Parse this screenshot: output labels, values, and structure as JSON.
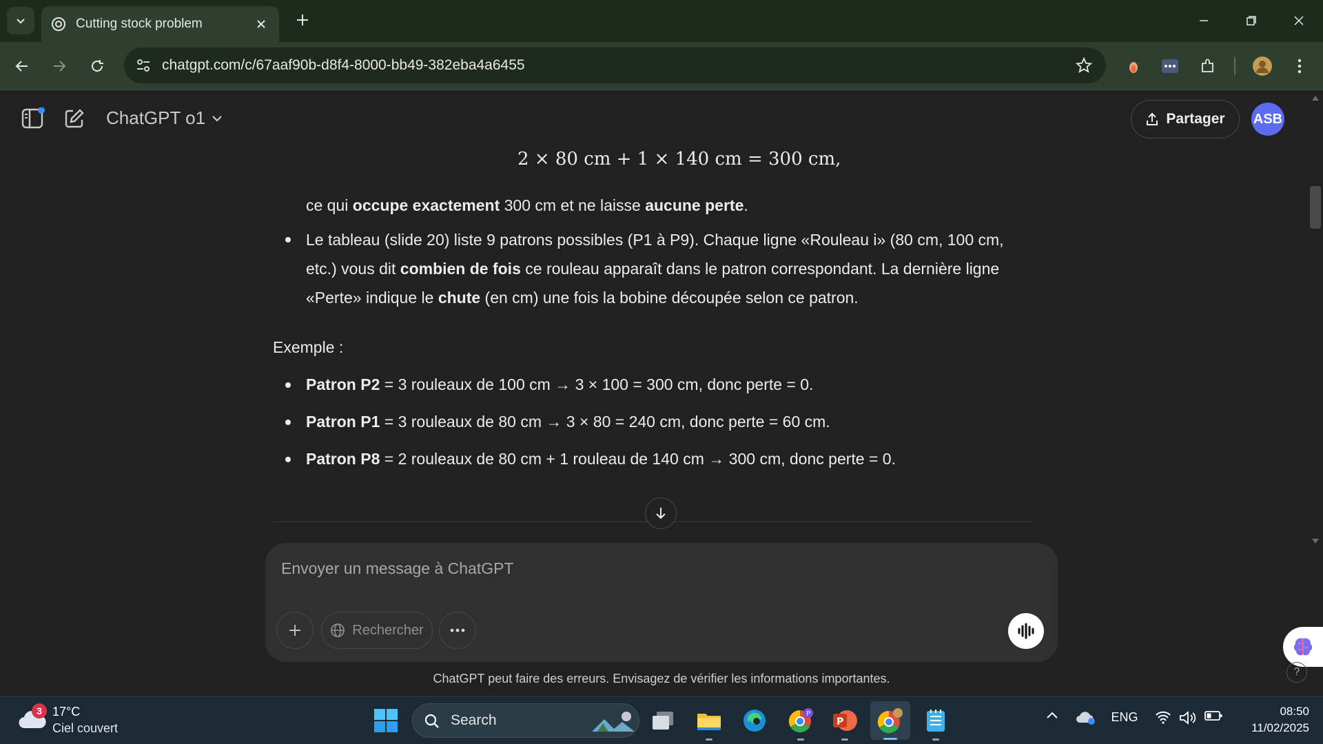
{
  "browser": {
    "tab_title": "Cutting stock problem",
    "url": "chatgpt.com/c/67aaf90b-d8f4-8000-bb49-382eba4a6455"
  },
  "header": {
    "model": "ChatGPT o1",
    "share_label": "Partager",
    "avatar_initials": "ASB"
  },
  "message": {
    "formula": "2 × 80 cm + 1 × 140 cm  =  300 cm,",
    "line1": {
      "t1": "ce qui ",
      "b1": "occupe exactement",
      "t2": " 300 cm et ne laisse ",
      "b2": "aucune perte",
      "t3": "."
    },
    "bullet_table": {
      "t1": "Le tableau (slide 20) liste 9 patrons possibles (P1 à P9). Chaque ligne «Rouleau i» (80 cm, 100 cm, etc.) vous dit ",
      "b1": "combien de fois",
      "t2": " ce rouleau apparaît dans le patron correspondant. La dernière ligne «Perte» indique le ",
      "b2": "chute",
      "t3": " (en cm) une fois la bobine découpée selon ce patron."
    },
    "example_heading": "Exemple :",
    "examples": [
      {
        "name": "Patron P2",
        "text": " = 3 rouleaux de 100 cm → 3 × 100 = 300 cm, donc perte = 0."
      },
      {
        "name": "Patron P1",
        "text": " = 3 rouleaux de 80 cm → 3 × 80 = 240 cm, donc perte = 60 cm."
      },
      {
        "name": "Patron P8",
        "text": " = 2 rouleaux de 80 cm + 1 rouleau de 140 cm → 300 cm, donc perte = 0."
      }
    ]
  },
  "composer": {
    "placeholder": "Envoyer un message à ChatGPT",
    "search_label": "Rechercher"
  },
  "disclaimer": "ChatGPT peut faire des erreurs. Envisagez de vérifier les informations importantes.",
  "taskbar": {
    "weather_temp": "17°C",
    "weather_desc": "Ciel couvert",
    "weather_badge": "3",
    "search_label": "Search",
    "language": "ENG",
    "time": "08:50",
    "date": "11/02/2025"
  },
  "colors": {
    "accent_avatar": "#5b6cf0",
    "browser_frame": "#2f3f2f",
    "background": "#212121"
  }
}
